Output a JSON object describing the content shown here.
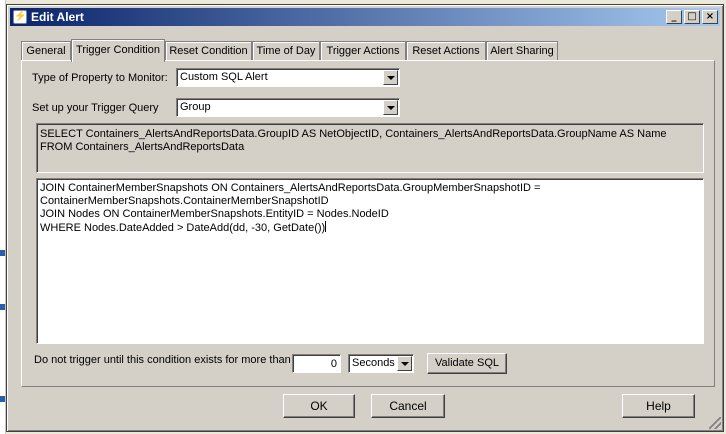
{
  "window": {
    "title": "Edit Alert",
    "controls": {
      "minimize": "_",
      "maximize": "□",
      "close": "×"
    }
  },
  "tabs": [
    {
      "label": "General"
    },
    {
      "label": "Trigger Condition"
    },
    {
      "label": "Reset Condition"
    },
    {
      "label": "Time of Day"
    },
    {
      "label": "Trigger Actions"
    },
    {
      "label": "Reset Actions"
    },
    {
      "label": "Alert Sharing"
    }
  ],
  "active_tab": "Trigger Condition",
  "form": {
    "property_label": "Type of Property to Monitor:",
    "property_value": "Custom SQL Alert",
    "query_label": "Set up your Trigger Query",
    "query_value": "Group",
    "sql_prefix": "SELECT Containers_AlertsAndReportsData.GroupID AS NetObjectID, Containers_AlertsAndReportsData.GroupName AS Name\nFROM Containers_AlertsAndReportsData",
    "sql_body": "JOIN ContainerMemberSnapshots ON Containers_AlertsAndReportsData.GroupMemberSnapshotID =\nContainerMemberSnapshots.ContainerMemberSnapshotID\nJOIN Nodes ON ContainerMemberSnapshots.EntityID = Nodes.NodeID\nWHERE Nodes.DateAdded > DateAdd(dd, -30, GetDate())",
    "delay_label": "Do not trigger until this condition exists for more than",
    "delay_value": "0",
    "delay_unit": "Seconds",
    "validate_label": "Validate SQL"
  },
  "footer": {
    "ok_label": "OK",
    "cancel_label": "Cancel",
    "help_label": "Help"
  },
  "colors": {
    "dialog_face": "#d4d0c8",
    "titlebar_start": "#0a246a",
    "titlebar_end": "#a6caf0"
  },
  "icons": {
    "title_icon": "alert-app-icon",
    "dropdown": "chevron-down-icon"
  }
}
